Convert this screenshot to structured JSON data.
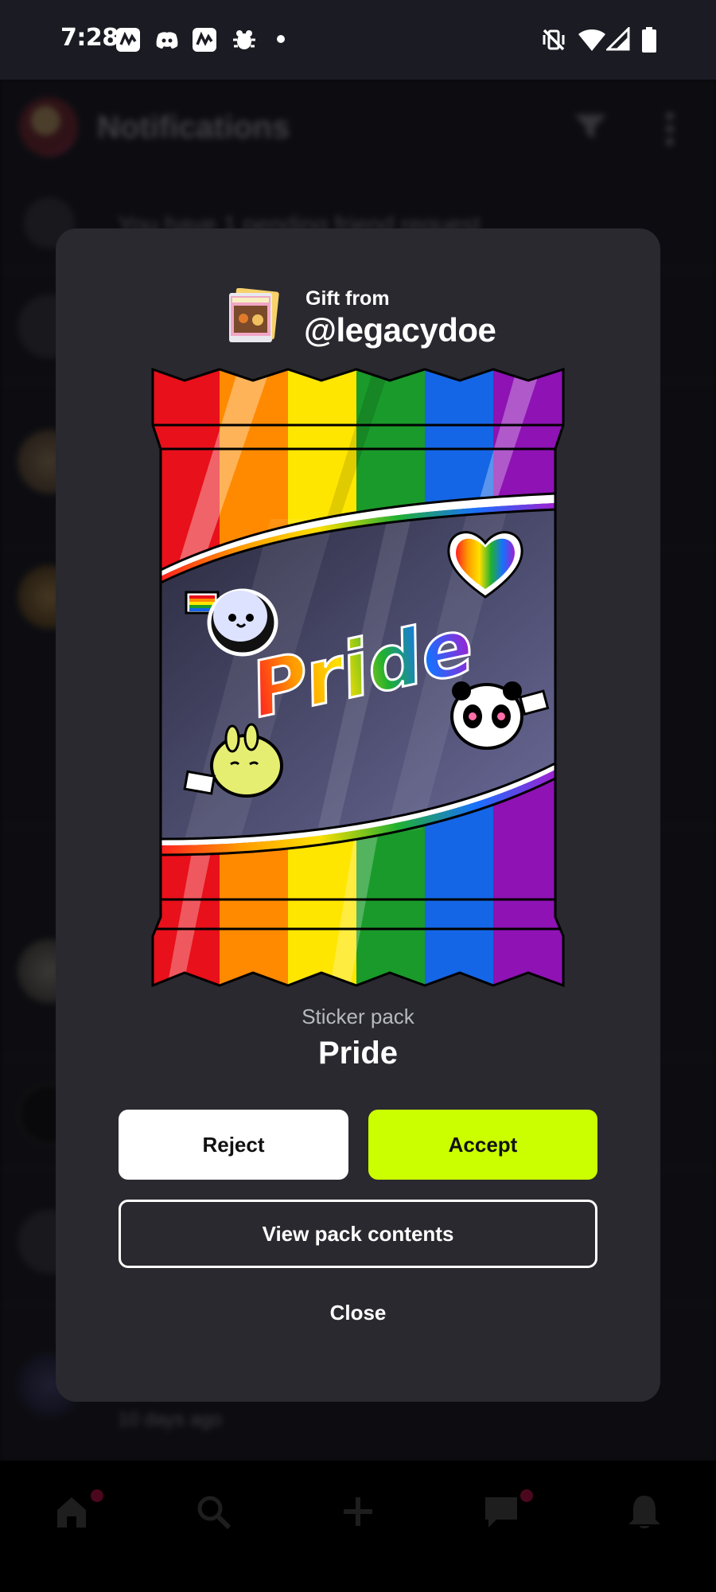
{
  "status_bar": {
    "time": "7:28",
    "left_icons": [
      "app-icon-a",
      "discord-icon",
      "app-icon-b",
      "bug-icon",
      "dot-icon"
    ],
    "right_icons": [
      "vibrate-off-icon",
      "wifi-icon",
      "signal-icon",
      "battery-icon"
    ]
  },
  "background": {
    "header_title": "Notifications",
    "rows": [
      {
        "text": "You have 1 pending friend request"
      }
    ],
    "nav_icons": [
      "home-icon",
      "search-icon",
      "add-icon",
      "chat-icon",
      "bell-icon"
    ],
    "footer_time": "10 days ago"
  },
  "modal": {
    "gift_from_label": "Gift from",
    "gift_username": "@legacydoe",
    "pack_art_text": "Pride",
    "pack_type": "Sticker pack",
    "pack_name": "Pride",
    "reject_label": "Reject",
    "accept_label": "Accept",
    "view_contents_label": "View pack contents",
    "close_label": "Close"
  },
  "colors": {
    "accent": "#cbff00",
    "modal_bg": "#29292f",
    "app_bg": "#1b1b23",
    "rainbow": [
      "#e8101a",
      "#ff8a00",
      "#ffe600",
      "#1a9a2a",
      "#1466e6",
      "#8e12b4"
    ]
  }
}
